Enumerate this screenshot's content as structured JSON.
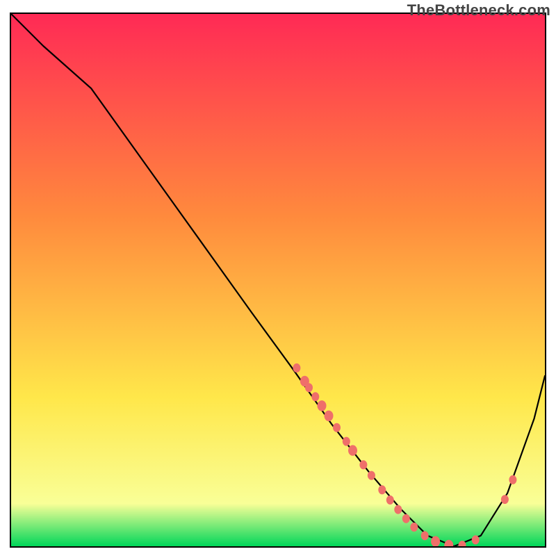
{
  "watermark": "TheBottleneck.com",
  "chart_data": {
    "type": "line",
    "title": "",
    "xlabel": "",
    "ylabel": "",
    "xlim": [
      0,
      100
    ],
    "ylim": [
      0,
      100
    ],
    "series": [
      {
        "name": "bottleneck-curve",
        "x": [
          0,
          6,
          15,
          25,
          35,
          45,
          53,
          60,
          67,
          73,
          78,
          83,
          88,
          93,
          98,
          100
        ],
        "y": [
          100,
          94,
          86,
          72,
          58,
          44,
          33,
          23,
          14,
          7,
          2,
          0,
          2,
          10,
          24,
          32
        ]
      }
    ],
    "markers": {
      "name": "highlight-markers",
      "points": [
        {
          "x": 53.5,
          "y": 33.5,
          "r": 5
        },
        {
          "x": 55,
          "y": 31,
          "r": 6
        },
        {
          "x": 55.8,
          "y": 29.8,
          "r": 5
        },
        {
          "x": 57,
          "y": 28.1,
          "r": 5
        },
        {
          "x": 58.2,
          "y": 26.4,
          "r": 6
        },
        {
          "x": 59.5,
          "y": 24.5,
          "r": 6
        },
        {
          "x": 61,
          "y": 22.3,
          "r": 5
        },
        {
          "x": 62.8,
          "y": 19.7,
          "r": 5
        },
        {
          "x": 64,
          "y": 18,
          "r": 6
        },
        {
          "x": 66,
          "y": 15.3,
          "r": 5
        },
        {
          "x": 67.5,
          "y": 13.3,
          "r": 5
        },
        {
          "x": 69.5,
          "y": 10.6,
          "r": 5
        },
        {
          "x": 71,
          "y": 8.7,
          "r": 5
        },
        {
          "x": 72.5,
          "y": 6.9,
          "r": 5
        },
        {
          "x": 74,
          "y": 5.2,
          "r": 5
        },
        {
          "x": 75.5,
          "y": 3.6,
          "r": 5
        },
        {
          "x": 77.5,
          "y": 2.0,
          "r": 5
        },
        {
          "x": 79.5,
          "y": 0.9,
          "r": 6
        },
        {
          "x": 82,
          "y": 0.2,
          "r": 6
        },
        {
          "x": 84.5,
          "y": 0.2,
          "r": 5
        },
        {
          "x": 87,
          "y": 1.2,
          "r": 5
        },
        {
          "x": 92.5,
          "y": 8.8,
          "r": 5
        },
        {
          "x": 94,
          "y": 12.5,
          "r": 5
        }
      ]
    },
    "gradient": {
      "top": "#ff2a55",
      "mid1": "#ff8a3d",
      "mid2": "#ffe74a",
      "mid3": "#f9ff97",
      "bottom": "#00d65a"
    }
  }
}
